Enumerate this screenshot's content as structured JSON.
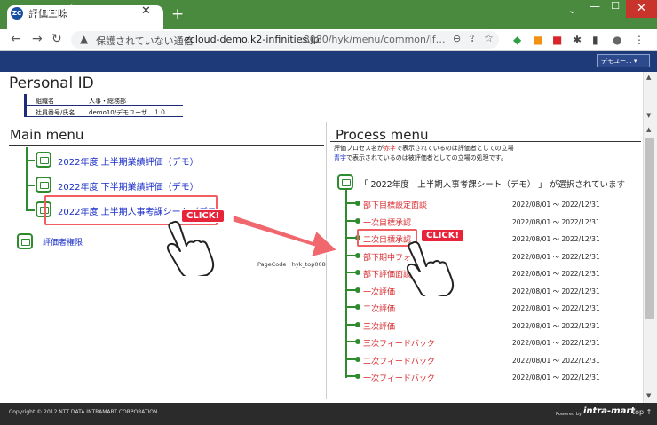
{
  "browser": {
    "tab_title": "評価三昧",
    "favicon_text": "ZC",
    "url_insecure": "保護されていない通信",
    "url_host": "zcloud-demo.k2-infinities.jp",
    "url_path": ":8080/hyk/menu/common/if…"
  },
  "app": {
    "logo": "zanmai",
    "menu_label": "評価三昧 ▾",
    "user_select": "デモユー... ▾"
  },
  "personal_id": {
    "title": "Personal ID",
    "rows": [
      {
        "label": "組織名",
        "value": "人事・総務部"
      },
      {
        "label": "社員番号/氏名",
        "value": "demo10/デモユーザ　１０"
      }
    ]
  },
  "main_menu": {
    "title": "Main menu",
    "items": [
      "2022年度 上半期業績評価（デモ）",
      "2022年度 下半期業績評価（デモ）",
      "2022年度 上半期人事考課シート（デモ）"
    ],
    "authority": "評価者権限",
    "page_code": "PageCode : hyk_top008"
  },
  "process_menu": {
    "title": "Process menu",
    "desc1_a": "評価プロセス名が",
    "desc1_red": "赤字",
    "desc1_b": "で表示されているのは評価者としての立場",
    "desc2_blue": "青字",
    "desc2_b": "で表示されているのは被評価者としての立場の処理です。",
    "selected": "「 2022年度　上半期人事考課シート（デモ） 」 が選択されています",
    "items": [
      {
        "label": "部下目標設定面談",
        "date": "2022/08/01 ～ 2022/12/31"
      },
      {
        "label": "一次目標承認",
        "date": "2022/08/01 ～ 2022/12/31"
      },
      {
        "label": "二次目標承認",
        "date": "2022/08/01 ～ 2022/12/31"
      },
      {
        "label": "部下期中フォ",
        "date": "2022/08/01 ～ 2022/12/31"
      },
      {
        "label": "部下評価面談",
        "date": "2022/08/01 ～ 2022/12/31"
      },
      {
        "label": "一次評価",
        "date": "2022/08/01 ～ 2022/12/31"
      },
      {
        "label": "二次評価",
        "date": "2022/08/01 ～ 2022/12/31"
      },
      {
        "label": "三次評価",
        "date": "2022/08/01 ～ 2022/12/31"
      },
      {
        "label": "三次フィードバック",
        "date": "2022/08/01 ～ 2022/12/31"
      },
      {
        "label": "二次フィードバック",
        "date": "2022/08/01 ～ 2022/12/31"
      },
      {
        "label": "一次フィードバック",
        "date": "2022/08/01 ～ 2022/12/31"
      }
    ]
  },
  "footer": {
    "copyright": "Copyright © 2012 NTT DATA INTRAMART CORPORATION.",
    "powered": "Powered by",
    "brand": "intra-mart",
    "top": "top ↑"
  },
  "annotation": {
    "click_label": "CLICK!"
  }
}
